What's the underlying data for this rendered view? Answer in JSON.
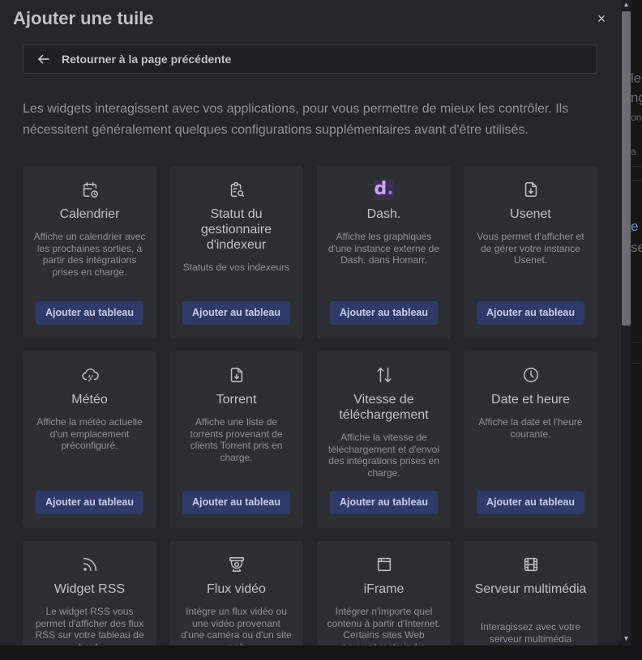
{
  "modal": {
    "title": "Ajouter une tuile",
    "close_glyph": "×",
    "back_label": "Retourner à la page précédente",
    "intro": "Les widgets interagissent avec vos applications, pour vous permettre de mieux les contrôler. Ils nécessitent généralement quelques configurations supplémentaires avant d'être utilisés."
  },
  "add_label": "Ajouter au tableau",
  "dash_logo": {
    "letter": "d",
    "dot": "."
  },
  "widgets": [
    {
      "title": "Calendrier",
      "desc": "Affiche un calendrier avec les prochaines sorties, à partir des intégrations prises en charge.",
      "icon": "calendar-clock-icon"
    },
    {
      "title": "Statut du gestionnaire d'indexeur",
      "desc": "Statuts de vos indexeurs",
      "icon": "clipboard-search-icon"
    },
    {
      "title": "Dash.",
      "desc": "Affiche les graphiques d'une instance externe de Dash. dans Homarr.",
      "icon": "dash-logo-icon"
    },
    {
      "title": "Usenet",
      "desc": "Vous permet d'afficher et de gérer votre instance Usenet.",
      "icon": "file-download-icon"
    },
    {
      "title": "Météo",
      "desc": "Affiche la météo actuelle d'un emplacement préconfiguré.",
      "icon": "cloud-rain-icon"
    },
    {
      "title": "Torrent",
      "desc": "Affiche une liste de torrents provenant de clients Torrent pris en charge.",
      "icon": "file-download-icon"
    },
    {
      "title": "Vitesse de téléchargement",
      "desc": "Affiche la vitesse de téléchargement et d'envoi des intégrations prises en charge.",
      "icon": "arrows-up-down-icon"
    },
    {
      "title": "Date et heure",
      "desc": "Affiche la date et l'heure courante.",
      "icon": "clock-icon"
    },
    {
      "title": "Widget RSS",
      "desc": "Le widget RSS vous permet d'afficher des flux RSS sur votre tableau de bord.",
      "icon": "rss-icon"
    },
    {
      "title": "Flux vidéo",
      "desc": "Intégre un flux vidéo ou une vidéo provenant d'une caméra ou d'un site web",
      "icon": "camera-icon"
    },
    {
      "title": "iFrame",
      "desc": "Intégrer n'importe quel contenu à partir d'Internet. Certains sites Web peuvent restreindre l'accès.",
      "icon": "browser-icon"
    },
    {
      "title": "Serveur multimédia",
      "desc": "Interagissez avec votre serveur multimédia",
      "icon": "film-icon"
    }
  ],
  "background_fragments": [
    "le",
    "ng",
    "on",
    "a",
    "e",
    "se"
  ]
}
